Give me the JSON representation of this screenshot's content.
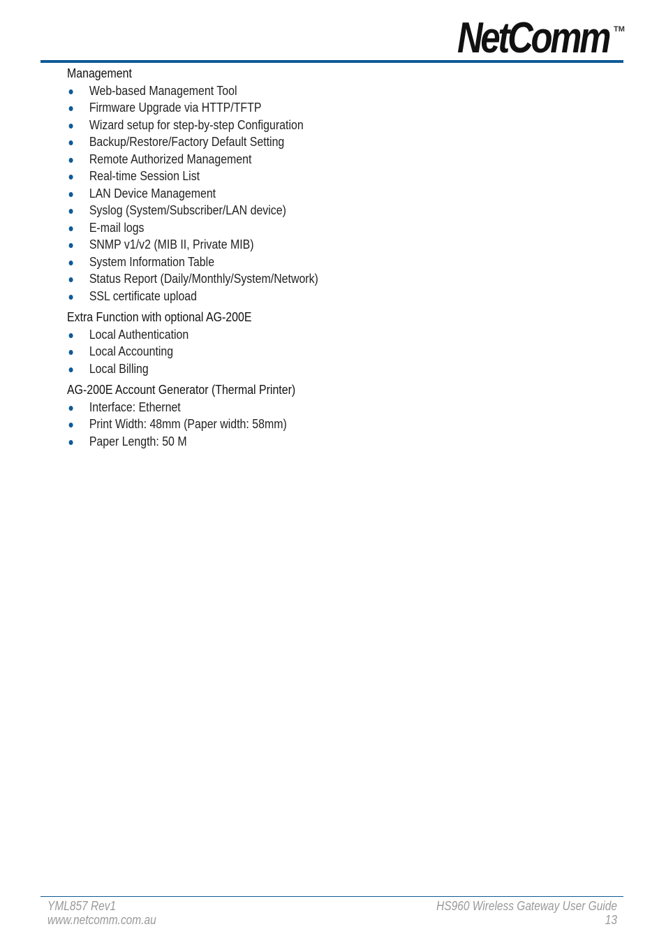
{
  "header": {
    "logo_text": "NetComm",
    "logo_tm": "TM"
  },
  "sections": [
    {
      "heading": "Management",
      "items": [
        "Web-based Management Tool",
        "Firmware Upgrade via HTTP/TFTP",
        "Wizard setup for step-by-step Configuration",
        "Backup/Restore/Factory Default Setting",
        "Remote Authorized Management",
        "Real-time Session List",
        "LAN Device Management",
        "Syslog (System/Subscriber/LAN device)",
        "E-mail logs",
        "SNMP v1/v2 (MIB II, Private MIB)",
        "System Information Table",
        "Status Report (Daily/Monthly/System/Network)",
        "SSL certificate upload"
      ]
    },
    {
      "heading": "Extra Function with optional AG-200E",
      "items": [
        "Local Authentication",
        "Local Accounting",
        "Local Billing"
      ]
    },
    {
      "heading": "AG-200E Account Generator (Thermal Printer)",
      "items": [
        "Interface: Ethernet",
        "Print Width: 48mm (Paper width: 58mm)",
        "Paper Length: 50 M"
      ]
    }
  ],
  "footer": {
    "doc_code": "YML857 Rev1",
    "website": "www.netcomm.com.au",
    "guide_title": "HS960 Wireless Gateway User Guide",
    "page_number": "13"
  }
}
